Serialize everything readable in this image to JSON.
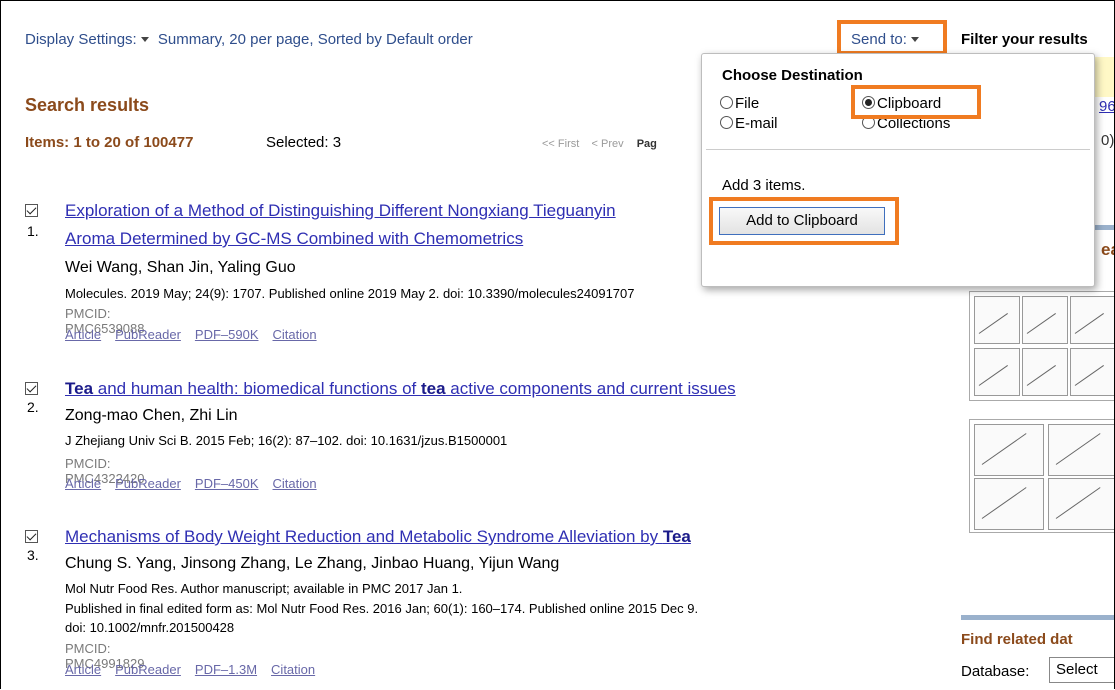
{
  "display_settings": {
    "label": "Display Settings:",
    "value": "Summary, 20 per page, Sorted by Default order"
  },
  "send_to": {
    "label": "Send to:"
  },
  "filter": {
    "title": "Filter your results"
  },
  "search": {
    "title": "Search results",
    "items_range": "Items: 1 to 20 of 100477",
    "selected": "Selected: 3",
    "pager_first": "<< First",
    "pager_prev": "< Prev",
    "pager_page": "Pag"
  },
  "results": [
    {
      "number": "1.",
      "title_line1": "Exploration of a Method of Distinguishing Different Nongxiang Tieguanyin",
      "title_line2": "Aroma Determined by GC-MS Combined with Chemometrics",
      "authors": "Wei Wang, Shan Jin, Yaling Guo",
      "citation": "Molecules. 2019 May; 24(9): 1707. Published online 2019 May 2. doi: 10.3390/molecules24091707",
      "pmcid": "PMCID: PMC6539088",
      "links": [
        "Article",
        "PubReader",
        "PDF–590K",
        "Citation"
      ]
    },
    {
      "number": "2.",
      "title_parts": [
        "Tea",
        " and human health: biomedical functions of ",
        "tea",
        " active components and current issues"
      ],
      "authors": "Zong-mao Chen, Zhi Lin",
      "citation": "J Zhejiang Univ Sci B. 2015 Feb; 16(2): 87–102. doi: 10.1631/jzus.B1500001",
      "pmcid": "PMCID: PMC4322420",
      "links": [
        "Article",
        "PubReader",
        "PDF–450K",
        "Citation"
      ]
    },
    {
      "number": "3.",
      "title_parts": [
        "Mechanisms of Body Weight Reduction and Metabolic Syndrome Alleviation by ",
        "Tea"
      ],
      "authors": "Chung S. Yang, Jinsong Zhang, Le Zhang, Jinbao Huang, Yijun Wang",
      "citation": "Mol Nutr Food Res. Author manuscript; available in PMC 2017 Jan 1.",
      "citation2": "Published in final edited form as: Mol Nutr Food Res. 2016 Jan; 60(1): 160–174. Published online 2015 Dec 9.",
      "citation3": "doi: 10.1002/mnfr.201500428",
      "pmcid": "PMCID: PMC4991829",
      "links": [
        "Article",
        "PubReader",
        "PDF–1.3M",
        "Citation"
      ]
    }
  ],
  "popup": {
    "header": "Choose Destination",
    "options": {
      "file": "File",
      "email": "E-mail",
      "clipboard": "Clipboard",
      "collections": "Collections"
    },
    "selected_option": "Clipboard",
    "add_count": "Add 3 items.",
    "add_button": "Add to Clipboard"
  },
  "sidebar": {
    "partial_link_1": "96",
    "partial_link_2": "0)",
    "partial_heading": "ea",
    "find_related": "Find related dat",
    "database_label": "Database:",
    "database_select": "Select"
  },
  "colors": {
    "accent_orange": "#f07b21",
    "link_blue": "#2f2fb3",
    "heading_brown": "#8b4a1b"
  }
}
